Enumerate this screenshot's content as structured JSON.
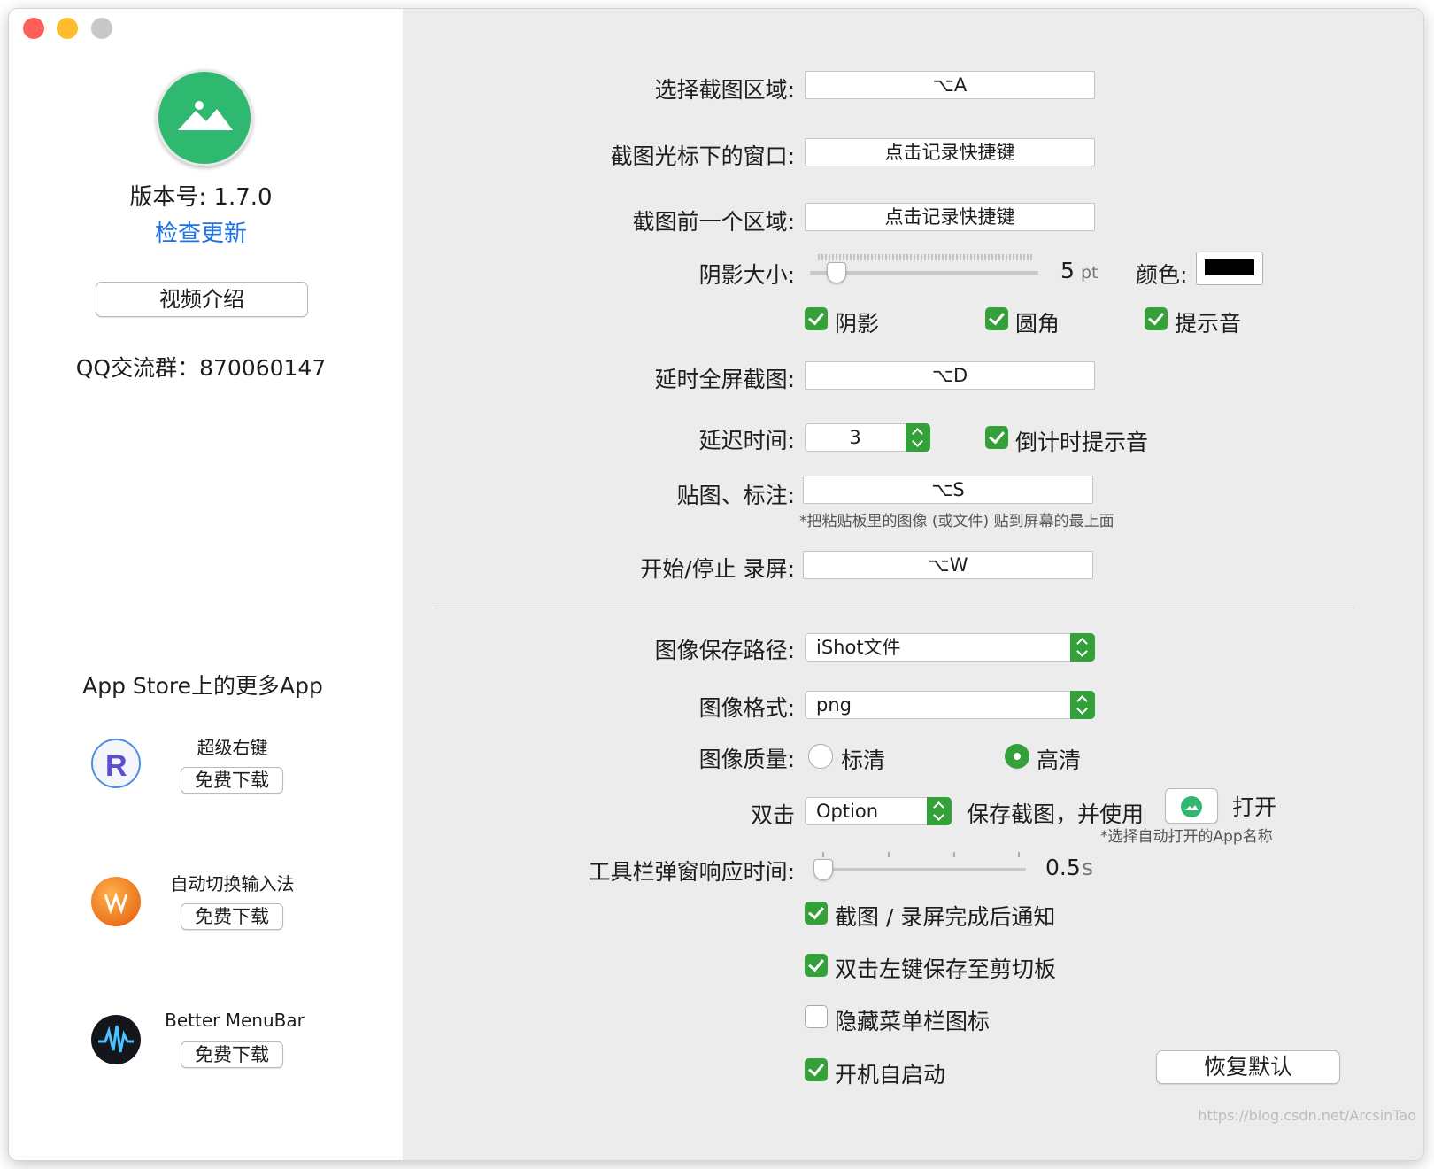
{
  "sidebar": {
    "version": "版本号: 1.7.0",
    "check_update": "检查更新",
    "video_button": "视频介绍",
    "qq_group": "QQ交流群：870060147",
    "more_apps_title": "App Store上的更多App",
    "apps": [
      {
        "name": "超级右键",
        "button": "免费下载"
      },
      {
        "name": "自动切换输入法",
        "button": "免费下载"
      },
      {
        "name": "Better MenuBar",
        "button": "免费下载"
      }
    ]
  },
  "shortcuts": {
    "select_area_label": "选择截图区域:",
    "select_area_value": "⌥A",
    "window_label": "截图光标下的窗口:",
    "window_value": "点击记录快捷键",
    "prev_area_label": "截图前一个区域:",
    "prev_area_value": "点击记录快捷键",
    "delay_fullscreen_label": "延时全屏截图:",
    "delay_fullscreen_value": "⌥D",
    "pin_label": "贴图、标注:",
    "pin_value": "⌥S",
    "pin_note": "*把粘贴板里的图像 (或文件) 贴到屏幕的最上面",
    "record_label": "开始/停止 录屏:",
    "record_value": "⌥W"
  },
  "shadow": {
    "label": "阴影大小:",
    "value": "5",
    "unit": "pt",
    "slider_fraction": 0.08,
    "color_label": "颜色:",
    "color": "#000000"
  },
  "toggles": {
    "shadow": {
      "label": "阴影",
      "checked": true
    },
    "round_corner": {
      "label": "圆角",
      "checked": true
    },
    "sound": {
      "label": "提示音",
      "checked": true
    },
    "countdown_sound": {
      "label": "倒计时提示音",
      "checked": true
    },
    "notify": {
      "label": "截图 / 录屏完成后通知",
      "checked": true
    },
    "dblclick_clipboard": {
      "label": "双击左键保存至剪切板",
      "checked": true
    },
    "hide_menubar": {
      "label": "隐藏菜单栏图标",
      "checked": false
    },
    "autostart": {
      "label": "开机自启动",
      "checked": true
    }
  },
  "delay": {
    "label": "延迟时间:",
    "value": "3"
  },
  "save": {
    "path_label": "图像保存路径:",
    "path_value": "iShot文件",
    "format_label": "图像格式:",
    "format_value": "png",
    "quality_label": "图像质量:",
    "quality_options": [
      "标清",
      "高清"
    ],
    "quality_selected": "高清"
  },
  "double_click": {
    "label": "双击",
    "modifier": "Option",
    "text": "保存截图，并使用",
    "open_label": "打开",
    "note": "*选择自动打开的App名称"
  },
  "toolbar_delay": {
    "label": "工具栏弹窗响应时间:",
    "value": "0.5",
    "unit": "s",
    "slider_fraction": 0.0
  },
  "restore_button": "恢复默认",
  "watermark": "https://blog.csdn.net/ArcsinTao",
  "colors": {
    "accent": "#34a03a",
    "link": "#1a73e8"
  }
}
